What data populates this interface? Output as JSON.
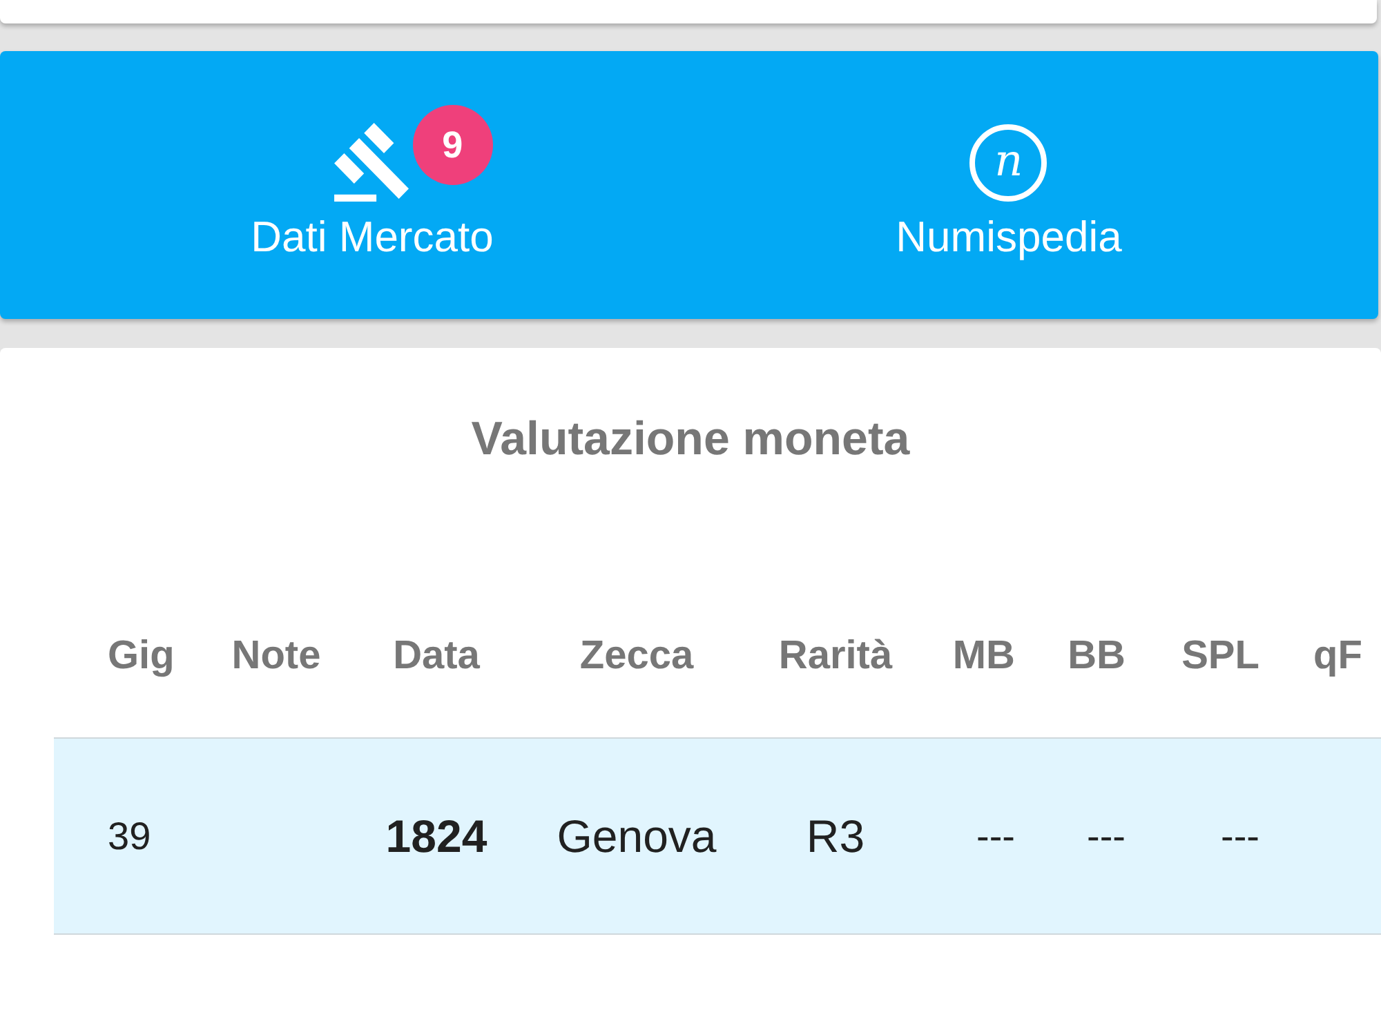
{
  "nav": {
    "items": [
      {
        "kind": "gavel",
        "label": "Dati Mercato",
        "badge": "9"
      },
      {
        "kind": "letter-logo",
        "label": "Numispedia",
        "logo_letter": "n"
      }
    ]
  },
  "valuation_card": {
    "title": "Valutazione moneta",
    "table": {
      "columns": [
        "Gig",
        "Note",
        "Data",
        "Zecca",
        "Rarità",
        "MB",
        "BB",
        "SPL",
        "qF"
      ],
      "rows": [
        {
          "highlighted": true,
          "cells": [
            "39",
            null,
            "1824",
            "Genova",
            "R3",
            "---",
            "---",
            "---"
          ]
        }
      ]
    }
  }
}
